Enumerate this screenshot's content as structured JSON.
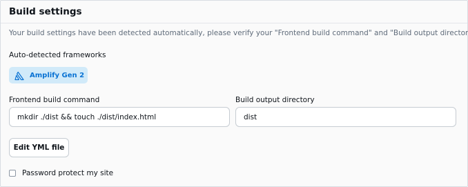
{
  "section": {
    "title": "Build settings",
    "description": "Your build settings have been detected automatically, please verify your \"Frontend build command\" and \"Build output directory\"."
  },
  "frameworks": {
    "label": "Auto-detected frameworks",
    "badge": {
      "text": "Amplify Gen 2",
      "icon": "amplify-logo-icon"
    }
  },
  "fields": {
    "build_command": {
      "label": "Frontend build command",
      "value": "mkdir ./dist && touch ./dist/index.html"
    },
    "output_directory": {
      "label": "Build output directory",
      "value": "dist"
    }
  },
  "actions": {
    "edit_yml": "Edit YML file"
  },
  "password": {
    "label": "Password protect my site",
    "checked": false
  },
  "colors": {
    "badge_background": "#d1eaf9",
    "badge_text": "#0972d3",
    "description_text": "#5f6b7a",
    "panel_background": "#fafafa",
    "border": "#c6ccd2"
  }
}
